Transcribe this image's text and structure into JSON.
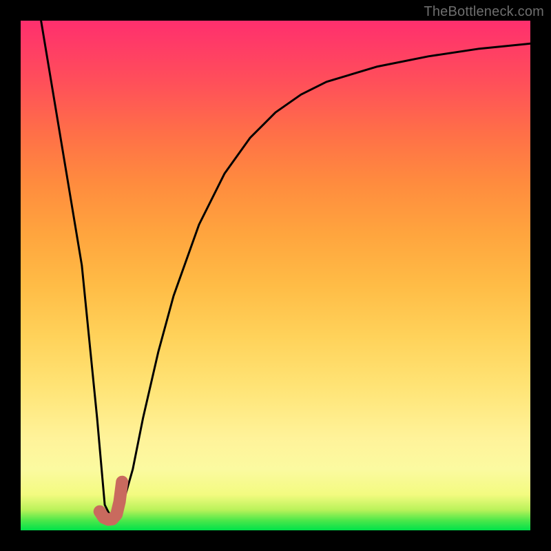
{
  "watermark": "TheBottleneck.com",
  "chart_data": {
    "type": "line",
    "title": "",
    "xlabel": "",
    "ylabel": "",
    "xlim": [
      0,
      100
    ],
    "ylim": [
      0,
      100
    ],
    "series": [
      {
        "name": "curve",
        "x": [
          4,
          8,
          12,
          15,
          16.5,
          18,
          19,
          20,
          22,
          24,
          27,
          30,
          35,
          40,
          45,
          50,
          55,
          60,
          70,
          80,
          90,
          100
        ],
        "y": [
          100,
          76,
          52,
          22,
          5,
          2,
          3,
          5,
          12,
          22,
          35,
          46,
          60,
          70,
          77,
          82,
          85.5,
          88,
          91,
          93,
          94.5,
          95.5
        ]
      }
    ],
    "marker": {
      "name": "highlight-j",
      "color": "#c96a5e",
      "x": [
        15.5,
        16.3,
        17.2,
        18.0,
        18.8,
        19.4,
        19.9
      ],
      "y": [
        3.7,
        2.5,
        2.1,
        2.2,
        3.1,
        5.6,
        9.5
      ]
    }
  }
}
